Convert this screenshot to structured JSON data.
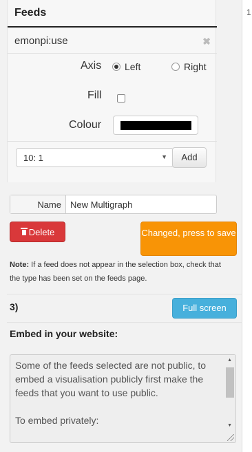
{
  "feeds": {
    "title": "Feeds",
    "feed_name": "emonpi:use",
    "remove_glyph": "✖",
    "axis_label": "Axis",
    "axis_options": [
      {
        "label": "Left",
        "selected": true
      },
      {
        "label": "Right",
        "selected": false
      }
    ],
    "fill_label": "Fill",
    "fill_checked": false,
    "colour_label": "Colour",
    "colour_value": "#000000",
    "select_value": "10: 1",
    "add_label": "Add"
  },
  "multigraph": {
    "name_label": "Name",
    "name_value": "New Multigraph",
    "delete_label": "Delete",
    "save_label": "Changed, press to save",
    "note_bold": "Note:",
    "note_text": " If a feed does not appear in the selection box, check that the type has been set on the feeds page."
  },
  "step3": {
    "label": "3)",
    "fullscreen_label": "Full screen"
  },
  "embed": {
    "title": "Embed in your website:",
    "paragraph1": "Some of the feeds selected are not public, to embed a visualisation publicly first make the feeds that you want to use public.",
    "paragraph2": "To embed privately:"
  },
  "side": {
    "number": "1"
  },
  "colors": {
    "delete": "#d9383a",
    "save": "#f89406",
    "fullscreen": "#47b0dc"
  }
}
